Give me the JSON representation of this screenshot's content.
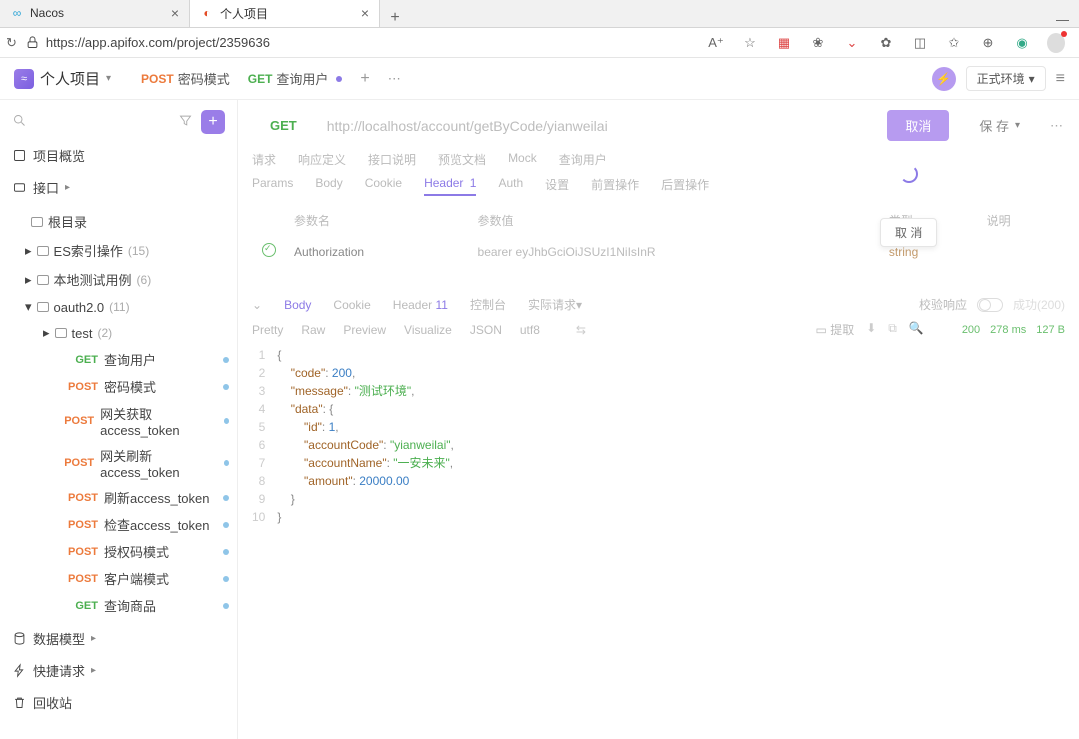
{
  "browser": {
    "tabs": [
      {
        "title": "Nacos",
        "icon": "∞",
        "iconColor": "#2ea5d6"
      },
      {
        "title": "个人项目",
        "icon": "◐",
        "iconColor": "#e34c26"
      }
    ],
    "url": "https://app.apifox.com/project/2359636",
    "urlIcons": {
      "lock": "🔒"
    }
  },
  "app": {
    "projectName": "个人项目",
    "env": "正式环境",
    "openTabs": [
      {
        "method": "POST",
        "label": "密码模式"
      },
      {
        "method": "GET",
        "label": "查询用户",
        "unsaved": true
      }
    ]
  },
  "sidebar": {
    "overview": "项目概览",
    "api": "接口",
    "rootDir": "根目录",
    "folders": [
      {
        "name": "ES索引操作",
        "count": "(15)",
        "expanded": false,
        "indent": 1
      },
      {
        "name": "本地测试用例",
        "count": "(6)",
        "expanded": false,
        "indent": 1
      },
      {
        "name": "oauth2.0",
        "count": "(11)",
        "expanded": true,
        "indent": 1
      },
      {
        "name": "test",
        "count": "(2)",
        "expanded": false,
        "indent": 2
      }
    ],
    "apis": [
      {
        "method": "GET",
        "name": "查询用户",
        "color": "#4caf50",
        "dot": "#8fc5e8"
      },
      {
        "method": "POST",
        "name": "密码模式",
        "color": "#ec7a3c",
        "dot": "#8fc5e8"
      },
      {
        "method": "POST",
        "name": "网关获取access_token",
        "color": "#ec7a3c",
        "dot": "#8fc5e8"
      },
      {
        "method": "POST",
        "name": "网关刷新access_token",
        "color": "#ec7a3c",
        "dot": "#8fc5e8"
      },
      {
        "method": "POST",
        "name": "刷新access_token",
        "color": "#ec7a3c",
        "dot": "#8fc5e8"
      },
      {
        "method": "POST",
        "name": "检查access_token",
        "color": "#ec7a3c",
        "dot": "#8fc5e8"
      },
      {
        "method": "POST",
        "name": "授权码模式",
        "color": "#ec7a3c",
        "dot": "#8fc5e8"
      },
      {
        "method": "POST",
        "name": "客户端模式",
        "color": "#ec7a3c",
        "dot": "#8fc5e8"
      },
      {
        "method": "GET",
        "name": "查询商品",
        "color": "#4caf50",
        "dot": "#8fc5e8"
      }
    ],
    "dataModel": "数据模型",
    "quickRequest": "快捷请求",
    "recycle": "回收站"
  },
  "request": {
    "method": "GET",
    "url": "http://localhost/account/getByCode/yianweilai",
    "sendBtn": "取消",
    "saveBtn": "保 存",
    "topTabs": [
      "请求",
      "响应定义",
      "接口说明",
      "预览文档",
      "Mock",
      "查询用户"
    ],
    "subTabs": {
      "items": [
        "Params",
        "Body",
        "Cookie",
        "Header",
        "Auth",
        "设置",
        "前置操作",
        "后置操作"
      ],
      "active": "Header",
      "headerBadge": "1"
    },
    "headerTable": {
      "cols": [
        "参数名",
        "参数值",
        "类型",
        "说明"
      ],
      "row": {
        "name": "Authorization",
        "value": "bearer eyJhbGciOiJSUzI1NiIsInR",
        "type": "string"
      }
    },
    "popover": "取 消"
  },
  "response": {
    "collapse": "⌄",
    "tabs": {
      "items": [
        "Body",
        "Cookie",
        "Header",
        "控制台",
        "实际请求▾"
      ],
      "active": "Body",
      "headerBadge": "11"
    },
    "verifyLabel": "校验响应",
    "fmtTabs": [
      "Pretty",
      "Raw",
      "Preview",
      "Visualize",
      "JSON",
      "utf8"
    ],
    "extract": "提取",
    "status": {
      "code": "200",
      "time": "278 ms",
      "size": "127 B"
    },
    "json": {
      "lines": [
        "{",
        "    \"code\": 200,",
        "    \"message\": \"测试环境\",",
        "    \"data\": {",
        "        \"id\": 1,",
        "        \"accountCode\": \"yianweilai\",",
        "        \"accountName\": \"一安未来\",",
        "        \"amount\": 20000.00",
        "    }",
        "}"
      ]
    }
  }
}
